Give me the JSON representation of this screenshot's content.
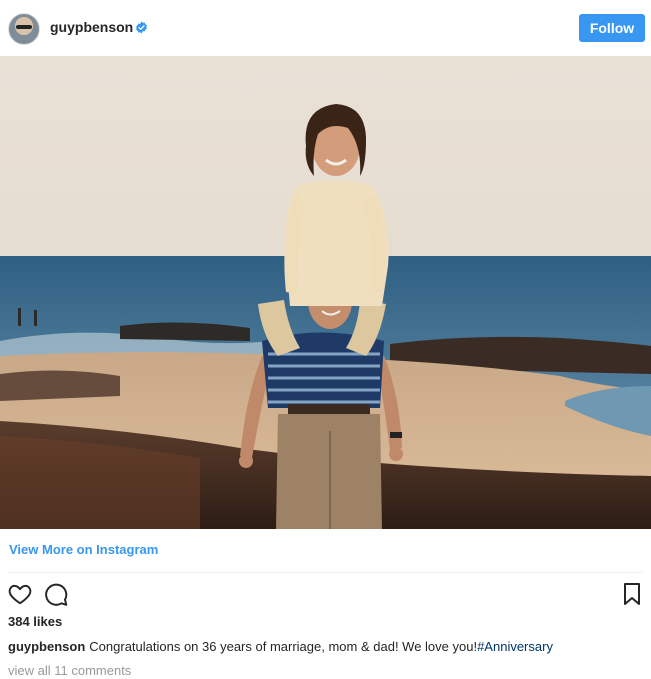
{
  "header": {
    "username": "guypbenson",
    "verified": true,
    "follow_label": "Follow"
  },
  "photo": {
    "subject": "vintage beach couple photo"
  },
  "view_more_label": "View More on Instagram",
  "likes": "384 likes",
  "caption": {
    "username": "guypbenson",
    "text": "Congratulations on 36 years of marriage, mom & dad! We love you!",
    "hashtag": "#Anniversary"
  },
  "view_comments": "view all 11 comments",
  "colors": {
    "accent": "#3897f0",
    "hashtag": "#003569",
    "muted": "#999999"
  }
}
